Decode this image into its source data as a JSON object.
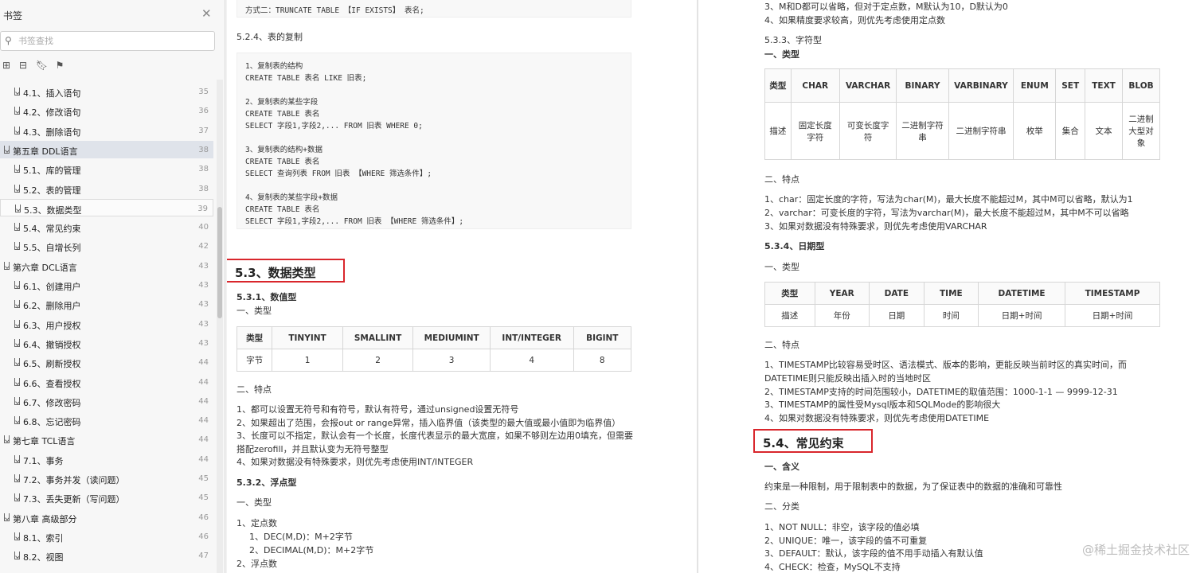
{
  "sidebar": {
    "title": "书签",
    "search_placeholder": "书签查找",
    "items": [
      {
        "label": "4.1、插入语句",
        "page": "35",
        "level": "sub"
      },
      {
        "label": "4.2、修改语句",
        "page": "36",
        "level": "sub"
      },
      {
        "label": "4.3、删除语句",
        "page": "37",
        "level": "sub"
      },
      {
        "label": "第五章 DDL语言",
        "page": "38",
        "level": "chapter",
        "selected": true
      },
      {
        "label": "5.1、库的管理",
        "page": "38",
        "level": "sub"
      },
      {
        "label": "5.2、表的管理",
        "page": "38",
        "level": "sub"
      },
      {
        "label": "5.3、数据类型",
        "page": "39",
        "level": "sub",
        "hover": true
      },
      {
        "label": "5.4、常见约束",
        "page": "40",
        "level": "sub"
      },
      {
        "label": "5.5、自增长列",
        "page": "42",
        "level": "sub"
      },
      {
        "label": "第六章 DCL语言",
        "page": "43",
        "level": "chapter"
      },
      {
        "label": "6.1、创建用户",
        "page": "43",
        "level": "sub"
      },
      {
        "label": "6.2、删除用户",
        "page": "43",
        "level": "sub"
      },
      {
        "label": "6.3、用户授权",
        "page": "43",
        "level": "sub"
      },
      {
        "label": "6.4、撤销授权",
        "page": "43",
        "level": "sub"
      },
      {
        "label": "6.5、刷新授权",
        "page": "44",
        "level": "sub"
      },
      {
        "label": "6.6、查看授权",
        "page": "44",
        "level": "sub"
      },
      {
        "label": "6.7、修改密码",
        "page": "44",
        "level": "sub"
      },
      {
        "label": "6.8、忘记密码",
        "page": "44",
        "level": "sub"
      },
      {
        "label": "第七章 TCL语言",
        "page": "44",
        "level": "chapter"
      },
      {
        "label": "7.1、事务",
        "page": "44",
        "level": "sub"
      },
      {
        "label": "7.2、事务并发（读问题）",
        "page": "45",
        "level": "sub"
      },
      {
        "label": "7.3、丢失更新（写问题）",
        "page": "45",
        "level": "sub"
      },
      {
        "label": "第八章 高级部分",
        "page": "46",
        "level": "chapter"
      },
      {
        "label": "8.1、索引",
        "page": "46",
        "level": "sub"
      },
      {
        "label": "8.2、视图",
        "page": "47",
        "level": "sub"
      }
    ]
  },
  "left": {
    "code_top": "方式二：TRUNCATE TABLE 【IF EXISTS】 表名;",
    "sec_524": "5.2.4、表的复制",
    "copy_code": [
      "1、复制表的结构",
      "CREATE TABLE 表名 LIKE 旧表;",
      "",
      "2、复制表的某些字段",
      "CREATE TABLE 表名",
      "SELECT 字段1,字段2,... FROM 旧表 WHERE 0;",
      "",
      "3、复制表的结构+数据",
      "CREATE TABLE 表名",
      "SELECT 查询列表 FROM 旧表 【WHERE 筛选条件】;",
      "",
      "4、复制表的某些字段+数据",
      "CREATE TABLE 表名",
      "SELECT 字段1,字段2,... FROM 旧表 【WHERE 筛选条件】;"
    ],
    "h53": "5.3、数据类型",
    "h531": "5.3.1、数值型",
    "type_label": "一、类型",
    "int_table": {
      "headers": [
        "类型",
        "TINYINT",
        "SMALLINT",
        "MEDIUMINT",
        "INT/INTEGER",
        "BIGINT"
      ],
      "row": [
        "字节",
        "1",
        "2",
        "3",
        "4",
        "8"
      ]
    },
    "feat_label": "二、特点",
    "int_features": [
      "1、都可以设置无符号和有符号，默认有符号，通过unsigned设置无符号",
      "2、如果超出了范围，会报out or range异常，插入临界值（该类型的最大值或最小值即为临界值）",
      "3、长度可以不指定，默认会有一个长度，长度代表显示的最大宽度，如果不够则左边用0填充，但需要",
      "搭配zerofill，并且默认变为无符号整型",
      "4、如果对数据没有特殊要求，则优先考虑使用INT/INTEGER"
    ],
    "h532": "5.3.2、浮点型",
    "type_label2": "一、类型",
    "float_lines": [
      "1、定点数",
      "1、DEC(M,D)：M+2字节",
      "2、DECIMAL(M,D)：M+2字节",
      "2、浮点数"
    ]
  },
  "right": {
    "top_lines": [
      "3、M和D都可以省略，但对于定点数，M默认为10，D默认为0",
      "4、如果精度要求较高，则优先考虑使用定点数"
    ],
    "h533": "5.3.3、字符型",
    "type_label": "一、类型",
    "str_table": {
      "headers": [
        "类型",
        "CHAR",
        "VARCHAR",
        "BINARY",
        "VARBINARY",
        "ENUM",
        "SET",
        "TEXT",
        "BLOB"
      ],
      "row": [
        "描述",
        "固定长度字符",
        "可变长度字符",
        "二进制字符串",
        "二进制字符串",
        "枚举",
        "集合",
        "文本",
        "二进制大型对象"
      ]
    },
    "feat_label": "二、特点",
    "str_features": [
      "1、char：固定长度的字符，写法为char(M)，最大长度不能超过M，其中M可以省略，默认为1",
      "2、varchar：可变长度的字符，写法为varchar(M)，最大长度不能超过M，其中M不可以省略",
      "3、如果对数据没有特殊要求，则优先考虑使用VARCHAR"
    ],
    "h534": "5.3.4、日期型",
    "type_label2": "一、类型",
    "date_table": {
      "headers": [
        "类型",
        "YEAR",
        "DATE",
        "TIME",
        "DATETIME",
        "TIMESTAMP"
      ],
      "row": [
        "描述",
        "年份",
        "日期",
        "时间",
        "日期+时间",
        "日期+时间"
      ]
    },
    "feat_label2": "二、特点",
    "date_features": [
      "1、TIMESTAMP比较容易受时区、语法模式、版本的影响，更能反映当前时区的真实时间，而",
      "DATETIME则只能反映出插入时的当地时区",
      "2、TIMESTAMP支持的时间范围较小，DATETIME的取值范围：1000-1-1 — 9999-12-31",
      "3、TIMESTAMP的属性受Mysql版本和SQLMode的影响很大",
      "4、如果对数据没有特殊要求，则优先考虑使用DATETIME"
    ],
    "h54": "5.4、常见约束",
    "meaning_label": "一、含义",
    "meaning": "约束是一种限制，用于限制表中的数据，为了保证表中的数据的准确和可靠性",
    "cat_label": "二、分类",
    "constraints": [
      "1、NOT NULL：非空，该字段的值必填",
      "2、UNIQUE：唯一，该字段的值不可重复",
      "3、DEFAULT：默认，该字段的值不用手动插入有默认值",
      "4、CHECK：检查，MySQL不支持"
    ]
  },
  "watermark": "@稀土掘金技术社区"
}
